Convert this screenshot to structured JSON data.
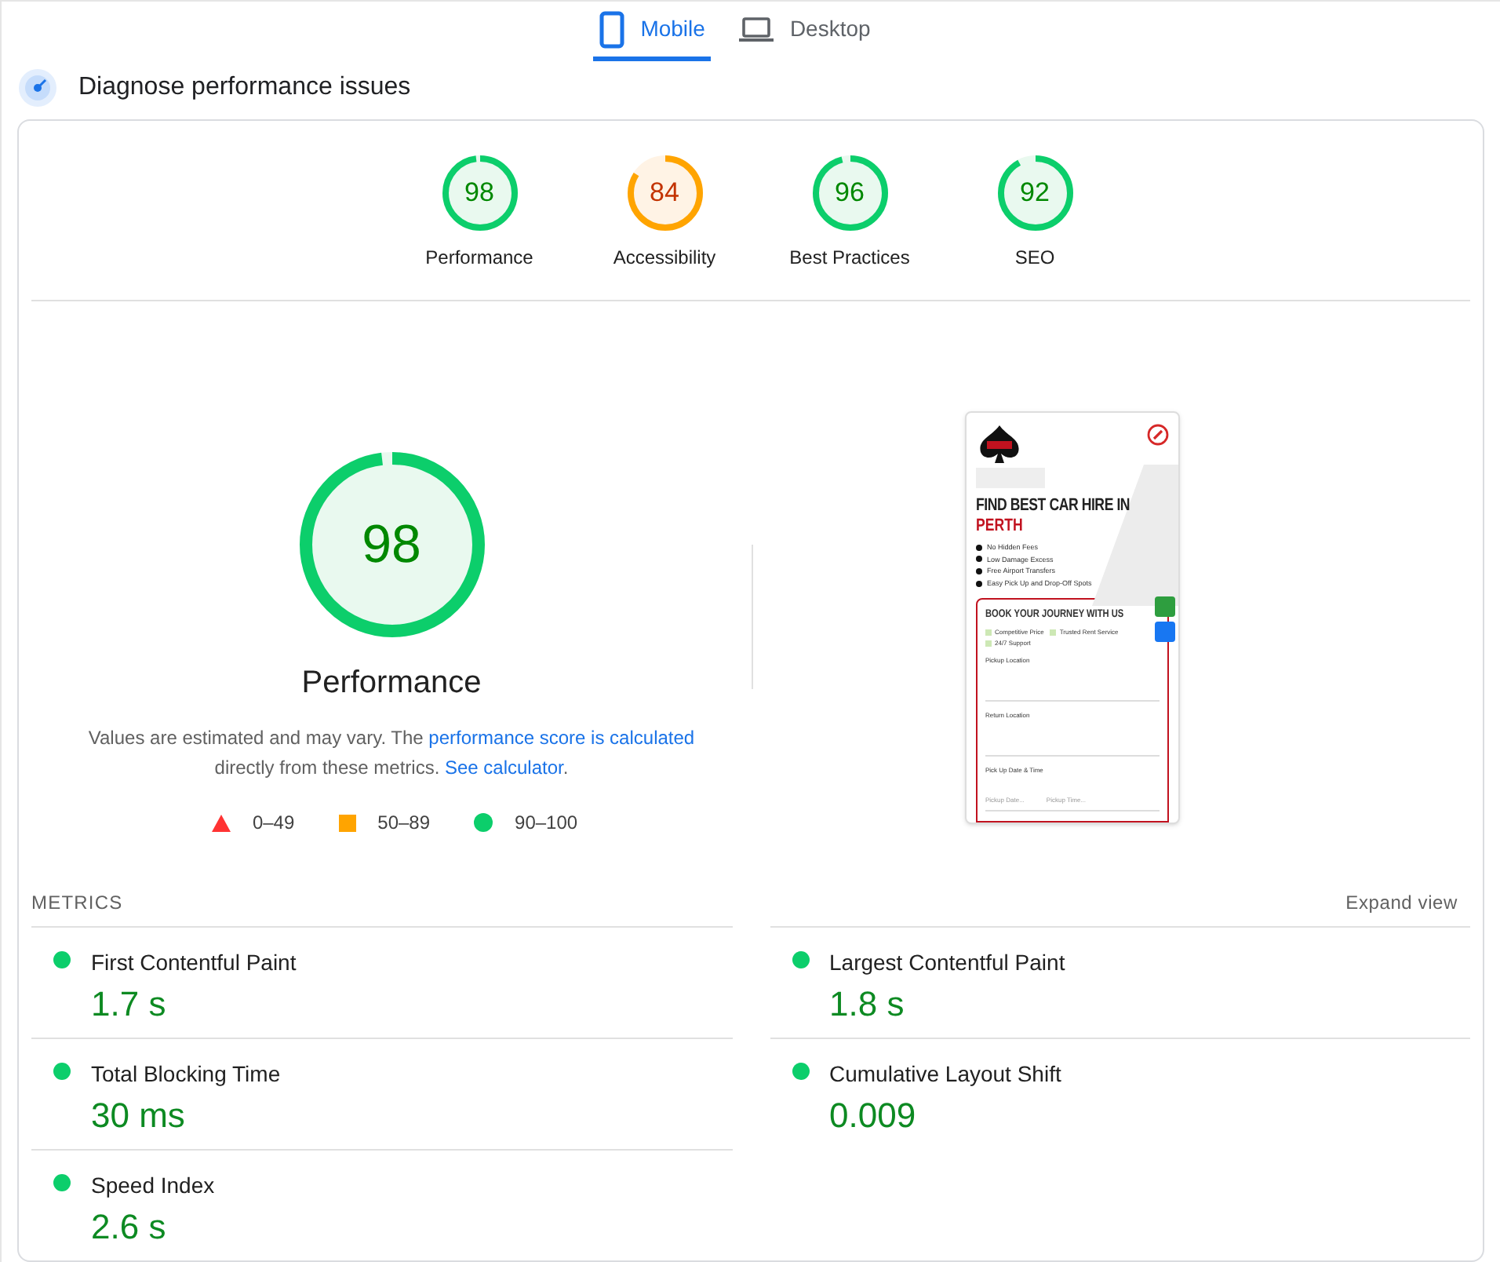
{
  "tabs": [
    {
      "label": "Mobile",
      "kind": "mobile",
      "selected": true
    },
    {
      "label": "Desktop",
      "kind": "desktop",
      "selected": false
    }
  ],
  "header": {
    "title": "Diagnose performance issues"
  },
  "scores": [
    {
      "value": "98",
      "label": "Performance",
      "level": 0.98
    },
    {
      "value": "84",
      "label": "Accessibility",
      "level": 0.84
    },
    {
      "value": "96",
      "label": "Best Practices",
      "level": 0.96
    },
    {
      "value": "92",
      "label": "SEO",
      "level": 0.92
    }
  ],
  "main_score": {
    "value": "98",
    "label": "Performance",
    "level": 0.98
  },
  "note": {
    "text_1": "Values are estimated and may vary. The ",
    "link_1": "performance score is calculated",
    "text_2": " directly from these metrics. ",
    "link_2": "See calculator",
    "text_3": "."
  },
  "legend": [
    {
      "kind": "fail",
      "label": "0–49"
    },
    {
      "kind": "average",
      "label": "50–89"
    },
    {
      "kind": "pass",
      "label": "90–100"
    }
  ],
  "preview": {
    "headline_1": "FIND BEST CAR HIRE IN",
    "headline_2": "PERTH",
    "bullets": [
      "No Hidden Fees",
      "Low Damage Excess",
      "Free Airport Transfers",
      "Easy Pick Up and Drop-Off Spots"
    ],
    "form_title": "BOOK YOUR JOURNEY WITH US",
    "features": [
      "Competitive Price",
      "Trusted Rent Service",
      "24/7 Support"
    ],
    "fields": [
      {
        "label": "Pickup Location"
      },
      {
        "label": "Return Location"
      },
      {
        "label": "Pick Up Date & Time",
        "placeholders": [
          "Pickup Date...",
          "Pickup Time..."
        ]
      }
    ]
  },
  "metrics_title": "METRICS",
  "expand": "Expand view",
  "metrics": [
    {
      "name": "First Contentful Paint",
      "value": "1.7 s",
      "color": "#0cce6b"
    },
    {
      "name": "Largest Contentful Paint",
      "value": "1.8 s",
      "color": "#0cce6b"
    },
    {
      "name": "Total Blocking Time",
      "value": "30 ms",
      "color": "#0cce6b"
    },
    {
      "name": "Cumulative Layout Shift",
      "value": "0.009",
      "color": "#0cce6b"
    },
    {
      "name": "Speed Index",
      "value": "2.6 s",
      "color": "#0cce6b"
    }
  ]
}
